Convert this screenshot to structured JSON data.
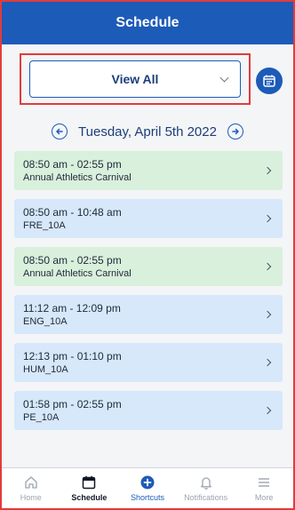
{
  "header": {
    "title": "Schedule"
  },
  "filter": {
    "value": "View All"
  },
  "date_nav": {
    "date": "Tuesday, April 5th 2022"
  },
  "events": [
    {
      "time": "08:50 am - 02:55 pm",
      "title": "Annual Athletics Carnival",
      "color": "green"
    },
    {
      "time": "08:50 am - 10:48 am",
      "title": "FRE_10A",
      "color": "blue"
    },
    {
      "time": "08:50 am - 02:55 pm",
      "title": "Annual Athletics Carnival",
      "color": "green"
    },
    {
      "time": "11:12 am - 12:09 pm",
      "title": "ENG_10A",
      "color": "blue"
    },
    {
      "time": "12:13 pm - 01:10 pm",
      "title": "HUM_10A",
      "color": "blue"
    },
    {
      "time": "01:58 pm - 02:55 pm",
      "title": "PE_10A",
      "color": "blue"
    }
  ],
  "tabs": [
    {
      "label": "Home",
      "icon": "home-icon"
    },
    {
      "label": "Schedule",
      "icon": "calendar-icon"
    },
    {
      "label": "Shortcuts",
      "icon": "plus-circle-icon"
    },
    {
      "label": "Notifications",
      "icon": "bell-icon"
    },
    {
      "label": "More",
      "icon": "menu-icon"
    }
  ],
  "colors": {
    "primary": "#1d5bb8",
    "green_card": "#d9f0dc",
    "blue_card": "#d6e8fa",
    "highlight": "#e23b3b"
  }
}
